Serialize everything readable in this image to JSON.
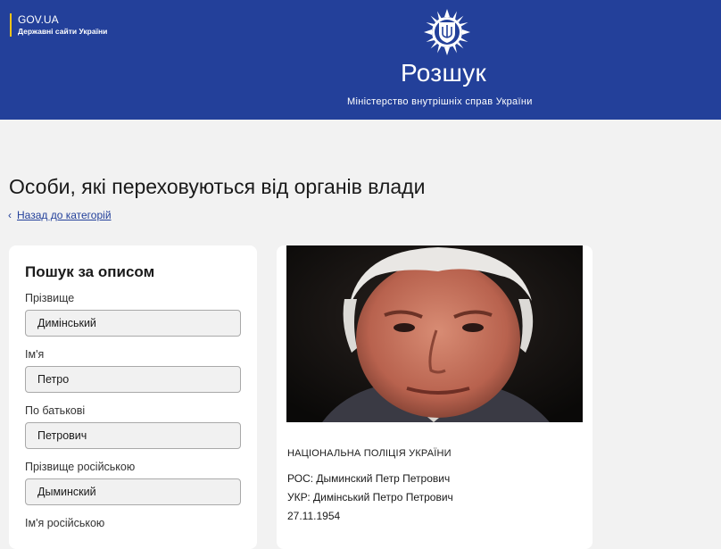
{
  "header": {
    "gov_title": "GOV.UA",
    "gov_subtitle": "Державні сайти України",
    "site_title": "Розшук",
    "site_subtitle": "Міністерство внутрішніх справ України",
    "brand_color": "#23409a",
    "accent_color": "#f0c419"
  },
  "page": {
    "title": "Особи, які переховуються від органів влади",
    "back_label": "Назад до категорій"
  },
  "search": {
    "title": "Пошук за описом",
    "fields": [
      {
        "label": "Прізвище",
        "value": "Димінський"
      },
      {
        "label": "Ім'я",
        "value": "Петро"
      },
      {
        "label": "По батькові",
        "value": "Петрович"
      },
      {
        "label": "Прізвище російською",
        "value": "Дыминский"
      },
      {
        "label": "Ім'я російською",
        "value": ""
      }
    ]
  },
  "result": {
    "photo_icon": "person-photo",
    "agency": "НАЦІОНАЛЬНА ПОЛІЦІЯ УКРАЇНИ",
    "ros": "РОС: Дыминский Петр Петрович",
    "ukr": "УКР: Димінський Петро Петрович",
    "date": "27.11.1954"
  }
}
